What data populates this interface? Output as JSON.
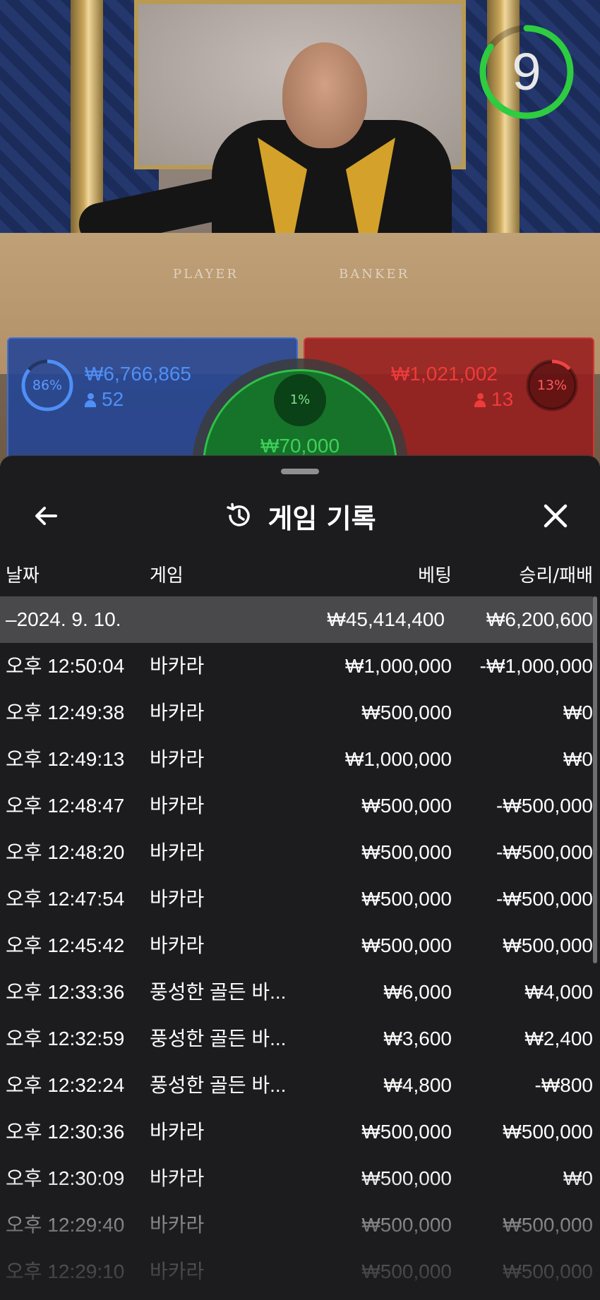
{
  "video": {
    "timer_value": "9",
    "table_labels": {
      "player": "PLAYER",
      "banker": "BANKER"
    }
  },
  "bets": {
    "player": {
      "percent": "86%",
      "percent_value": 86,
      "amount": "₩6,766,865",
      "count": "52",
      "color": "#3b82f6"
    },
    "banker": {
      "percent": "13%",
      "percent_value": 13,
      "amount": "₩1,021,002",
      "count": "13",
      "color": "#ef4444"
    },
    "tie": {
      "percent": "1%",
      "amount": "₩70,000",
      "color": "#22c55e"
    }
  },
  "sheet": {
    "title": "게임 기록",
    "icons": {
      "back": "arrow-left-icon",
      "history": "history-icon",
      "close": "close-icon"
    },
    "columns": {
      "date": "날짜",
      "game": "게임",
      "bet": "베팅",
      "result": "승리/패배"
    },
    "summary": {
      "date": "–2024. 9. 10.",
      "bet": "₩45,414,400",
      "result": "₩6,200,600"
    },
    "rows": [
      {
        "time": "오후 12:50:04",
        "game": "바카라",
        "bet": "₩1,000,000",
        "result": "-₩1,000,000"
      },
      {
        "time": "오후 12:49:38",
        "game": "바카라",
        "bet": "₩500,000",
        "result": "₩0"
      },
      {
        "time": "오후 12:49:13",
        "game": "바카라",
        "bet": "₩1,000,000",
        "result": "₩0"
      },
      {
        "time": "오후 12:48:47",
        "game": "바카라",
        "bet": "₩500,000",
        "result": "-₩500,000"
      },
      {
        "time": "오후 12:48:20",
        "game": "바카라",
        "bet": "₩500,000",
        "result": "-₩500,000"
      },
      {
        "time": "오후 12:47:54",
        "game": "바카라",
        "bet": "₩500,000",
        "result": "-₩500,000"
      },
      {
        "time": "오후 12:45:42",
        "game": "바카라",
        "bet": "₩500,000",
        "result": "₩500,000"
      },
      {
        "time": "오후 12:33:36",
        "game": "풍성한 골든 바...",
        "bet": "₩6,000",
        "result": "₩4,000"
      },
      {
        "time": "오후 12:32:59",
        "game": "풍성한 골든 바...",
        "bet": "₩3,600",
        "result": "₩2,400"
      },
      {
        "time": "오후 12:32:24",
        "game": "풍성한 골든 바...",
        "bet": "₩4,800",
        "result": "-₩800"
      },
      {
        "time": "오후 12:30:36",
        "game": "바카라",
        "bet": "₩500,000",
        "result": "₩500,000"
      },
      {
        "time": "오후 12:30:09",
        "game": "바카라",
        "bet": "₩500,000",
        "result": "₩0"
      },
      {
        "time": "오후 12:29:40",
        "game": "바카라",
        "bet": "₩500,000",
        "result": "₩500,000"
      },
      {
        "time": "오후 12:29:10",
        "game": "바카라",
        "bet": "₩500,000",
        "result": "₩500,000"
      }
    ]
  }
}
